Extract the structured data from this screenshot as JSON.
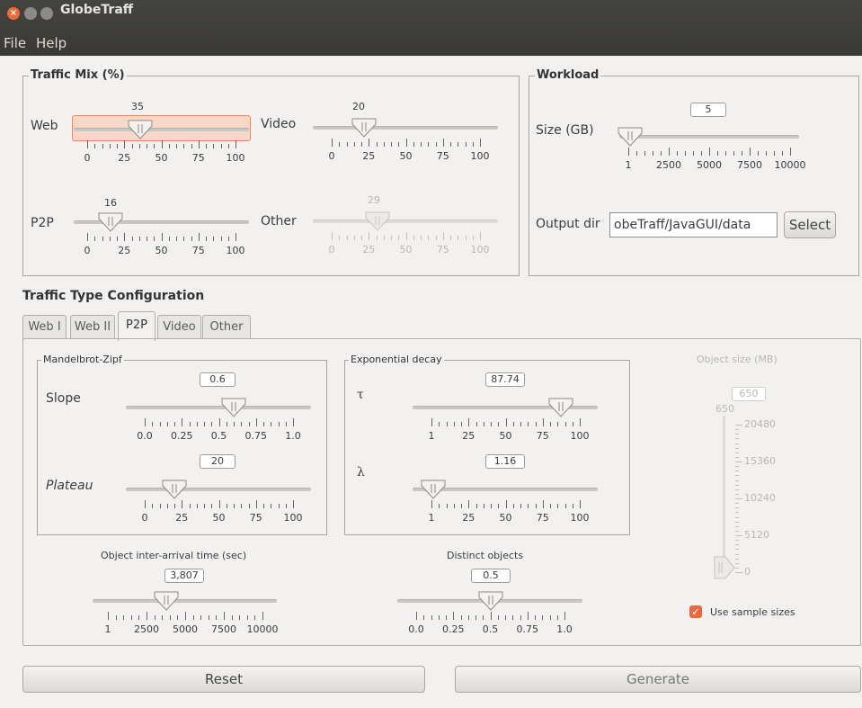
{
  "window": {
    "title": "GlobeTraff"
  },
  "menu": {
    "file": "File",
    "help": "Help"
  },
  "traffic_mix": {
    "title": "Traffic Mix (%)",
    "web": {
      "label": "Web",
      "value": "35"
    },
    "video": {
      "label": "Video",
      "value": "20"
    },
    "p2p": {
      "label": "P2P",
      "value": "16"
    },
    "other": {
      "label": "Other",
      "value": "29"
    },
    "ticks": [
      "0",
      "25",
      "50",
      "75",
      "100"
    ]
  },
  "workload": {
    "title": "Workload",
    "size_label": "Size (GB)",
    "size_value": "5",
    "size_ticks": [
      "1",
      "2500",
      "5000",
      "7500",
      "10000"
    ],
    "output_label": "Output dir",
    "output_value": "obeTraff/JavaGUI/data",
    "select_button": "Select"
  },
  "config": {
    "title": "Traffic Type Configuration",
    "tabs": [
      "Web I",
      "Web II",
      "P2P",
      "Video",
      "Other"
    ],
    "active_tab": "P2P",
    "mandelbrot": {
      "title": "Mandelbrot-Zipf",
      "slope_label": "Slope",
      "slope_value": "0.6",
      "slope_ticks": [
        "0.0",
        "0.25",
        "0.5",
        "0.75",
        "1.0"
      ],
      "plateau_label": "Plateau",
      "plateau_value": "20",
      "plateau_ticks": [
        "0",
        "25",
        "50",
        "75",
        "100"
      ]
    },
    "exponential": {
      "title": "Exponential decay",
      "tau_label": "τ",
      "tau_value": "87.74",
      "tau_ticks": [
        "1",
        "25",
        "50",
        "75",
        "100"
      ],
      "lambda_label": "λ",
      "lambda_value": "1.16",
      "lambda_ticks": [
        "1",
        "25",
        "50",
        "75",
        "100"
      ]
    },
    "interarrival": {
      "label": "Object inter-arrival time (sec)",
      "value": "3,807",
      "ticks": [
        "1",
        "2500",
        "5000",
        "7500",
        "10000"
      ]
    },
    "distinct": {
      "label": "Distinct objects",
      "value": "0.5",
      "ticks": [
        "0.0",
        "0.25",
        "0.5",
        "0.75",
        "1.0"
      ]
    },
    "object_size": {
      "label": "Object size (MB)",
      "value": "650",
      "top_value": "650",
      "ticks": [
        "20480",
        "15360",
        "10240",
        "5120",
        "0"
      ],
      "use_sample_sizes": "Use sample sizes"
    }
  },
  "buttons": {
    "reset": "Reset",
    "generate": "Generate"
  }
}
